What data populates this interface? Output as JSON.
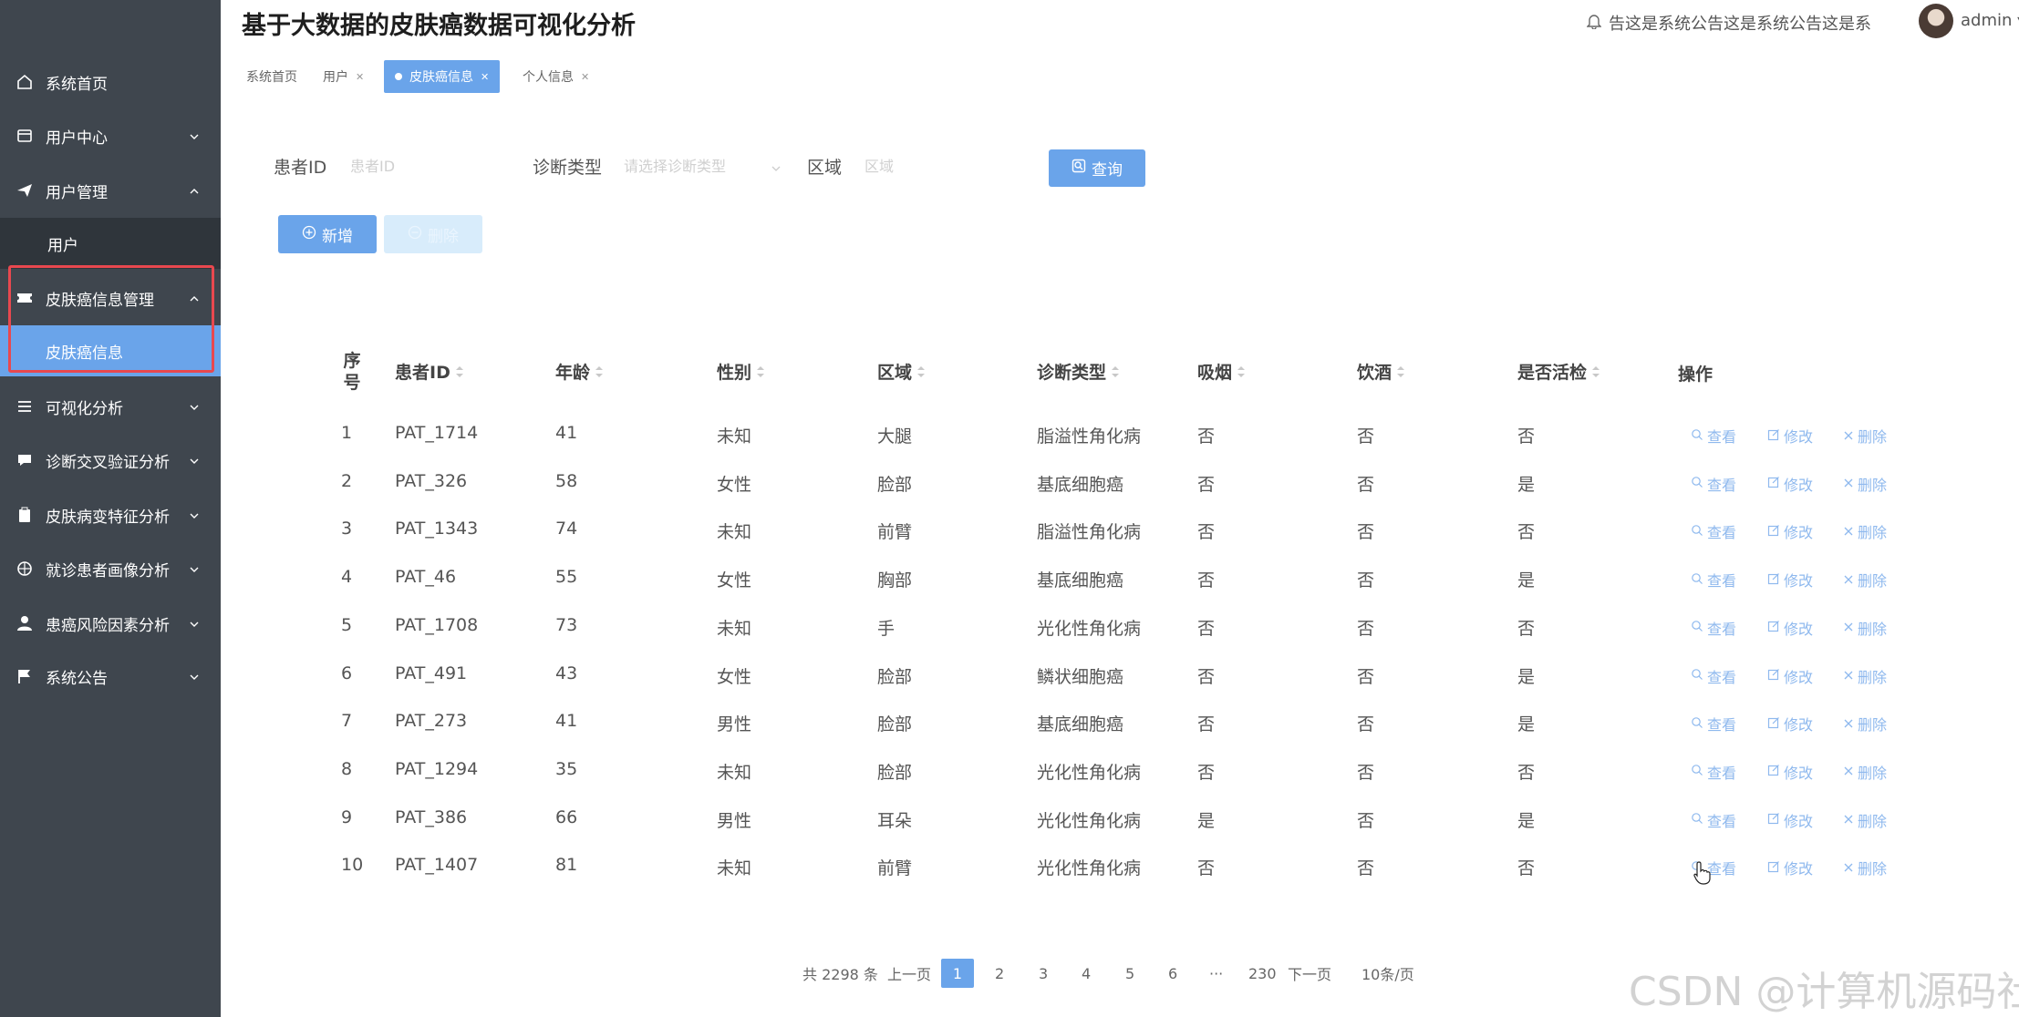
{
  "header": {
    "title": "基于大数据的皮肤癌数据可视化分析",
    "notice": "告这是系统公告这是系统公告这是系",
    "username": "admin"
  },
  "sidebar": {
    "items": [
      {
        "label": "系统首页",
        "icon": "home-icon"
      },
      {
        "label": "用户中心",
        "icon": "card-icon"
      },
      {
        "label": "用户管理",
        "icon": "send-icon"
      },
      {
        "label": "用户",
        "icon": ""
      },
      {
        "label": "皮肤癌信息管理",
        "icon": "ticket-icon"
      },
      {
        "label": "皮肤癌信息",
        "icon": ""
      },
      {
        "label": "可视化分析",
        "icon": "list-icon"
      },
      {
        "label": "诊断交叉验证分析",
        "icon": "chat-icon"
      },
      {
        "label": "皮肤病变特征分析",
        "icon": "clipboard-icon"
      },
      {
        "label": "就诊患者画像分析",
        "icon": "globe-icon"
      },
      {
        "label": "患癌风险因素分析",
        "icon": "user-icon"
      },
      {
        "label": "系统公告",
        "icon": "flag-icon"
      }
    ]
  },
  "tabs": [
    {
      "label": "系统首页",
      "closable": false
    },
    {
      "label": "用户",
      "closable": true
    },
    {
      "label": "皮肤癌信息",
      "closable": true,
      "active": true
    },
    {
      "label": "个人信息",
      "closable": true
    }
  ],
  "search": {
    "patient_id_label": "患者ID",
    "patient_id_placeholder": "患者ID",
    "diagnosis_label": "诊断类型",
    "diagnosis_placeholder": "请选择诊断类型",
    "region_label": "区域",
    "region_placeholder": "区域",
    "query_label": "查询"
  },
  "toolbar": {
    "add_label": "新增",
    "delete_label": "删除"
  },
  "table": {
    "headers": [
      "序号",
      "患者ID",
      "年龄",
      "性别",
      "区域",
      "诊断类型",
      "吸烟",
      "饮酒",
      "是否活检",
      "操作"
    ],
    "rows": [
      [
        "1",
        "PAT_1714",
        "41",
        "未知",
        "大腿",
        "脂溢性角化病",
        "否",
        "否",
        "否"
      ],
      [
        "2",
        "PAT_326",
        "58",
        "女性",
        "脸部",
        "基底细胞癌",
        "否",
        "否",
        "是"
      ],
      [
        "3",
        "PAT_1343",
        "74",
        "未知",
        "前臂",
        "脂溢性角化病",
        "否",
        "否",
        "否"
      ],
      [
        "4",
        "PAT_46",
        "55",
        "女性",
        "胸部",
        "基底细胞癌",
        "否",
        "否",
        "是"
      ],
      [
        "5",
        "PAT_1708",
        "73",
        "未知",
        "手",
        "光化性角化病",
        "否",
        "否",
        "否"
      ],
      [
        "6",
        "PAT_491",
        "43",
        "女性",
        "脸部",
        "鳞状细胞癌",
        "否",
        "否",
        "是"
      ],
      [
        "7",
        "PAT_273",
        "41",
        "男性",
        "脸部",
        "基底细胞癌",
        "否",
        "否",
        "是"
      ],
      [
        "8",
        "PAT_1294",
        "35",
        "未知",
        "脸部",
        "光化性角化病",
        "否",
        "否",
        "否"
      ],
      [
        "9",
        "PAT_386",
        "66",
        "男性",
        "耳朵",
        "光化性角化病",
        "是",
        "否",
        "是"
      ],
      [
        "10",
        "PAT_1407",
        "81",
        "未知",
        "前臂",
        "光化性角化病",
        "否",
        "否",
        "否"
      ]
    ],
    "actions": [
      "查看",
      "修改",
      "删除"
    ]
  },
  "pagination": {
    "total": "共 2298 条",
    "prev": "上一页",
    "pages": [
      "1",
      "2",
      "3",
      "4",
      "5",
      "6",
      "···",
      "230"
    ],
    "current": "1",
    "next": "下一页",
    "page_size": "10条/页"
  },
  "watermark": "CSDN @计算机源码社",
  "colors": {
    "sidebar_bg": "#3f464e",
    "accent": "#6aa4ea",
    "highlight_box": "#e8484f"
  }
}
